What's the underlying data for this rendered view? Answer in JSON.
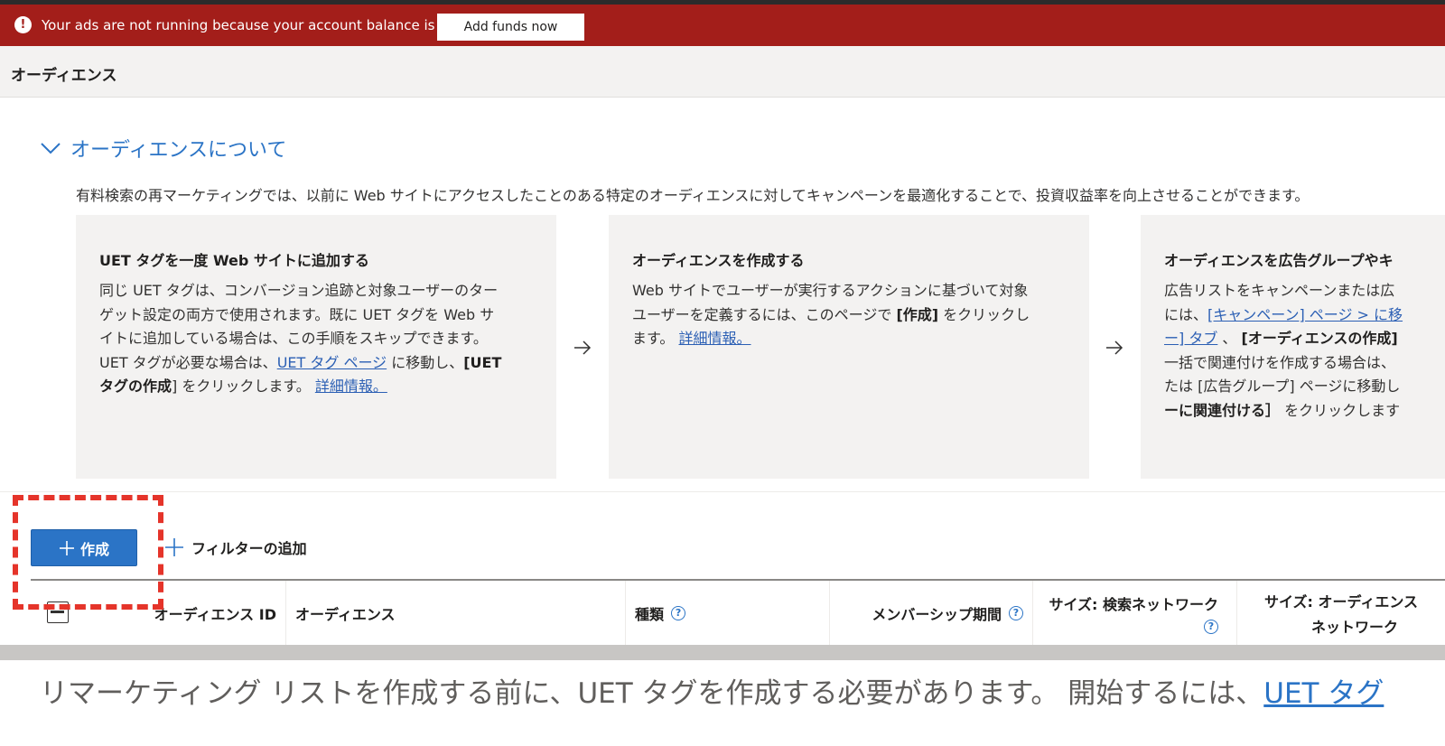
{
  "banner": {
    "icon": "alert-circle-icon",
    "message": "Your ads are not running because your account balance is zero.",
    "button_label": "Add funds now"
  },
  "page": {
    "title": "オーディエンス"
  },
  "about": {
    "toggle_icon": "chevron-down-icon",
    "title": "オーディエンスについて",
    "intro": "有料検索の再マーケティングでは、以前に Web サイトにアクセスしたことのある特定のオーディエンスに対してキャンペーンを最適化することで、投資収益率を向上させることができます。"
  },
  "cards": [
    {
      "title": "UET タグを一度 Web サイトに追加する",
      "lines": [
        "同じ UET タグは、コンバージョン追跡と対象ユーザーのター",
        "ゲット設定の両方で使用されます。既に UET タグを Web サ",
        "イトに追加している場合は、この手順をスキップできます。"
      ],
      "line4_pre": "UET タグが必要な場合は、",
      "link1": "UET タグ ページ",
      "line4_mid": " に移動し、",
      "line4_bold": "[UET",
      "line5_bold": "タグの作成",
      "line5_rest": "] をクリックします。 ",
      "link2": "詳細情報。"
    },
    {
      "title": "オーディエンスを作成する",
      "line1": "Web サイトでユーザーが実行するアクションに基づいて対象",
      "line2_pre": "ユーザーを定義するには、このページで ",
      "line2_bold": "[作成]",
      "line2_post": " をクリックし",
      "line3_pre": "ます。 ",
      "link": "詳細情報。"
    },
    {
      "title": "オーディエンスを広告グループやキ",
      "line1": "広告リストをキャンペーンまたは広",
      "line2_pre": "には、",
      "line2_link": "[キャンペーン] ページ > に移",
      "line3_link": "ー] タブ",
      "line3_mid": " 、",
      "line3_bold": "[オーディエンスの作成]",
      "line4": "一括で関連付けを作成する場合は、",
      "line5": "たは [広告グループ] ページに移動し",
      "line6_bold": "ーに関連付ける］",
      "line6_rest": " をクリックします"
    }
  ],
  "toolbar": {
    "create_label": "作成",
    "filter_label": "フィルターの追加"
  },
  "table": {
    "columns": [
      {
        "label": "オーディエンス ID"
      },
      {
        "label": "オーディエンス"
      },
      {
        "label": "種類",
        "help": "?"
      },
      {
        "label": "メンバーシップ期間",
        "help": "?"
      },
      {
        "label": "サイズ: 検索ネットワーク",
        "help": "?"
      },
      {
        "label_line1": "サイズ: オーディエンス",
        "label_line2": "ネットワーク"
      }
    ]
  },
  "footer": {
    "message": "リマーケティング リストを作成する前に、UET タグを作成する必要があります。 開始するには、",
    "link": "UET タグ"
  }
}
